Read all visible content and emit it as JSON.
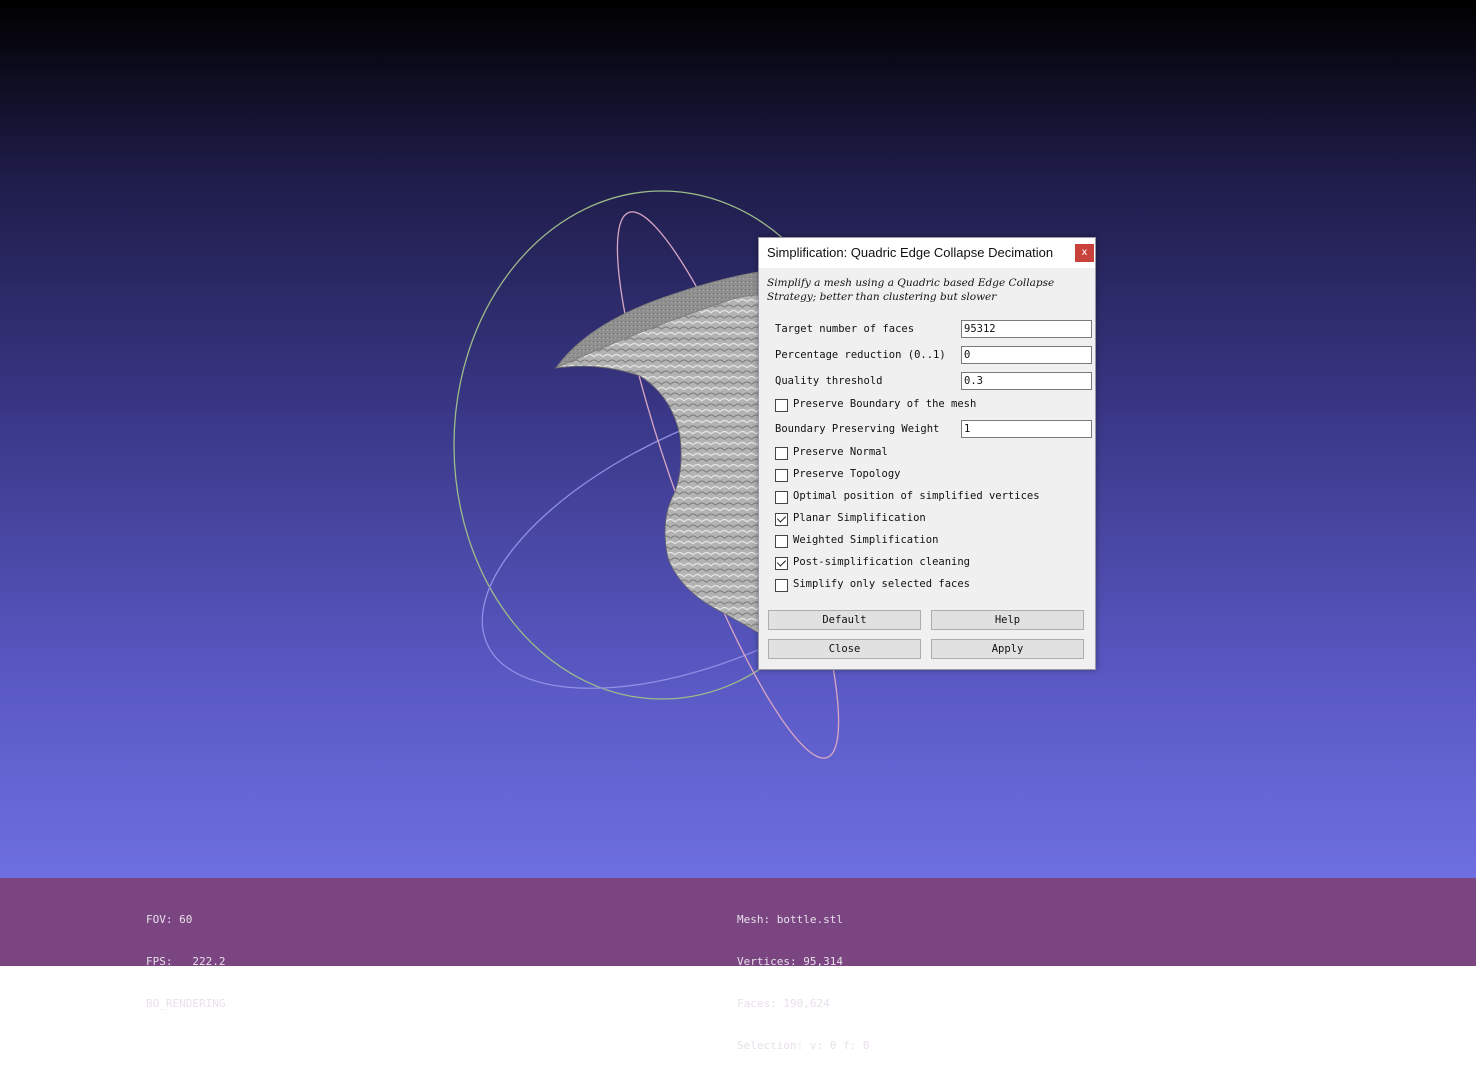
{
  "dialog": {
    "title": "Simplification: Quadric Edge Collapse Decimation",
    "close_glyph": "x",
    "description_line1": "Simplify a mesh using a Quadric based Edge Collapse",
    "description_line2": "Strategy; better than clustering but slower",
    "fields": {
      "target_faces": {
        "label": "Target number of faces",
        "value": "95312"
      },
      "percentage": {
        "label": "Percentage reduction (0..1)",
        "value": "0"
      },
      "quality": {
        "label": "Quality threshold",
        "value": "0.3"
      },
      "boundary_weight": {
        "label": "Boundary Preserving Weight",
        "value": "1"
      }
    },
    "checkboxes": {
      "preserve_boundary": {
        "label": "Preserve Boundary of the mesh",
        "checked": false
      },
      "preserve_normal": {
        "label": "Preserve Normal",
        "checked": false
      },
      "preserve_topology": {
        "label": "Preserve Topology",
        "checked": false
      },
      "optimal_position": {
        "label": "Optimal position of simplified vertices",
        "checked": false
      },
      "planar": {
        "label": "Planar Simplification",
        "checked": true
      },
      "weighted": {
        "label": "Weighted Simplification",
        "checked": false
      },
      "post_cleaning": {
        "label": "Post-simplification cleaning",
        "checked": true
      },
      "selected_only": {
        "label": "Simplify only selected faces",
        "checked": false
      }
    },
    "buttons": {
      "default": "Default",
      "help": "Help",
      "close": "Close",
      "apply": "Apply"
    }
  },
  "status_left": {
    "fov": "FOV: 60",
    "fps": "FPS:   222.2",
    "mode": "BO_RENDERING"
  },
  "status_right": {
    "mesh": "Mesh: bottle.stl",
    "vertices": "Vertices: 95,314",
    "faces": "Faces: 190,624",
    "selection": "Selection: v: 0 f: 0"
  },
  "colors": {
    "infobar": "#7a4580",
    "close_button": "#c8413b",
    "trackball_green": "#9dbb8a",
    "trackball_pink": "#d9a7c4",
    "trackball_blue": "#8f90e6"
  }
}
